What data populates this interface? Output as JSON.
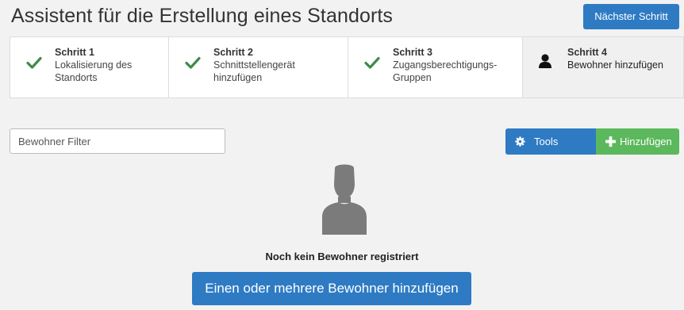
{
  "header": {
    "title": "Assistent für die Erstellung eines Standorts",
    "next_step_label": "Nächster Schritt"
  },
  "steps": [
    {
      "title": "Schritt 1",
      "description_lines": [
        "Lokalisierung des",
        "Standorts"
      ],
      "status": "completed",
      "icon": "check-icon"
    },
    {
      "title": "Schritt 2",
      "description_lines": [
        "Schnittstellengerät",
        "hinzufügen"
      ],
      "status": "completed",
      "icon": "check-icon"
    },
    {
      "title": "Schritt 3",
      "description_lines": [
        "Zugangsberechtigungs-",
        "Gruppen"
      ],
      "status": "completed",
      "icon": "check-icon"
    },
    {
      "title": "Schritt 4",
      "description_lines": [
        "Bewohner hinzufügen"
      ],
      "status": "active",
      "icon": "user-icon"
    }
  ],
  "toolbar": {
    "filter_placeholder": "Bewohner Filter",
    "filter_value": "",
    "tools_label": "Tools",
    "tools_icon": "gear-icon",
    "add_label": "Hinzufügen",
    "add_icon": "plus-icon"
  },
  "empty_state": {
    "icon": "user-silhouette-icon",
    "message": "Noch kein Bewohner registriert",
    "action_label": "Einen oder mehrere Bewohner hinzufügen"
  },
  "colors": {
    "primary": "#2e7bc4",
    "success": "#5cb85c",
    "check": "#3d8b4a",
    "background": "#f2f2f2",
    "active_step_bg": "#f0f0f0"
  }
}
